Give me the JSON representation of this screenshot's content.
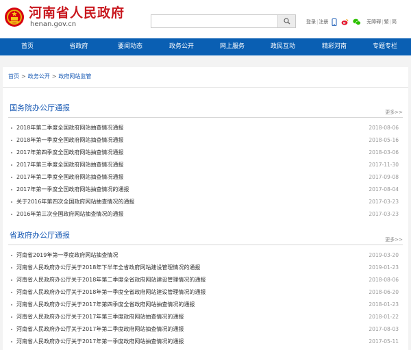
{
  "header": {
    "title": "河南省人民政府",
    "domain": "henan.gov.cn",
    "search_placeholder": "",
    "login": "登录",
    "register": "注册",
    "accessibility": "无障碍",
    "traditional": "繁",
    "simplified": "简",
    "brand_color": "#c8161d"
  },
  "nav": {
    "color": "#0a5fb3",
    "items": [
      "首页",
      "省政府",
      "要闻动态",
      "政务公开",
      "网上服务",
      "政民互动",
      "精彩河南",
      "专题专栏"
    ]
  },
  "breadcrumb": [
    "首页",
    "政务公开",
    "政府网站监管"
  ],
  "sections": [
    {
      "title": "国务院办公厅通报",
      "more": "更多>>",
      "items": [
        {
          "title": "2018年第二季度全国政府网站抽查情况通报",
          "date": "2018-08-06"
        },
        {
          "title": "2018年第一季度全国政府网站抽查情况通报",
          "date": "2018-05-16"
        },
        {
          "title": "2017年第四季度全国政府网站抽查情况通报",
          "date": "2018-03-06"
        },
        {
          "title": "2017年第三季度全国政府网站抽查情况通报",
          "date": "2017-11-30"
        },
        {
          "title": "2017年第二季度全国政府网站抽查情况通报",
          "date": "2017-09-08"
        },
        {
          "title": "2017年第一季度全国政府网站抽查情况的通报",
          "date": "2017-08-04"
        },
        {
          "title": "关于2016年第四次全国政府网站抽查情况的通报",
          "date": "2017-03-23"
        },
        {
          "title": "2016年第三次全国政府网站抽查情况的通报",
          "date": "2017-03-23"
        }
      ]
    },
    {
      "title": "省政府办公厅通报",
      "more": "更多>>",
      "items": [
        {
          "title": "河南省2019年第一季度政府网站抽查情况",
          "date": "2019-03-20"
        },
        {
          "title": "河南省人民政府办公厅关于2018年下半年全省政府网站建设管理情况的通报",
          "date": "2019-01-23"
        },
        {
          "title": "河南省人民政府办公厅关于2018年第二季度全省政府网站建设管理情况的通报",
          "date": "2018-08-06"
        },
        {
          "title": "河南省人民政府办公厅关于2018年第一季度全省政府网站建设管理情况的通报",
          "date": "2018-06-20"
        },
        {
          "title": "河南省人民政府办公厅关于2017年第四季度全省政府网站抽查情况的通报",
          "date": "2018-01-23"
        },
        {
          "title": "河南省人民政府办公厅关于2017年第三季度政府网站抽查情况的通报",
          "date": "2018-01-22"
        },
        {
          "title": "河南省人民政府办公厅关于2017年第二季度政府网站抽查情况的通报",
          "date": "2017-08-03"
        },
        {
          "title": "河南省人民政府办公厅关于2017年第一季度政府网站抽查情况的通报",
          "date": "2017-05-11"
        }
      ]
    }
  ]
}
